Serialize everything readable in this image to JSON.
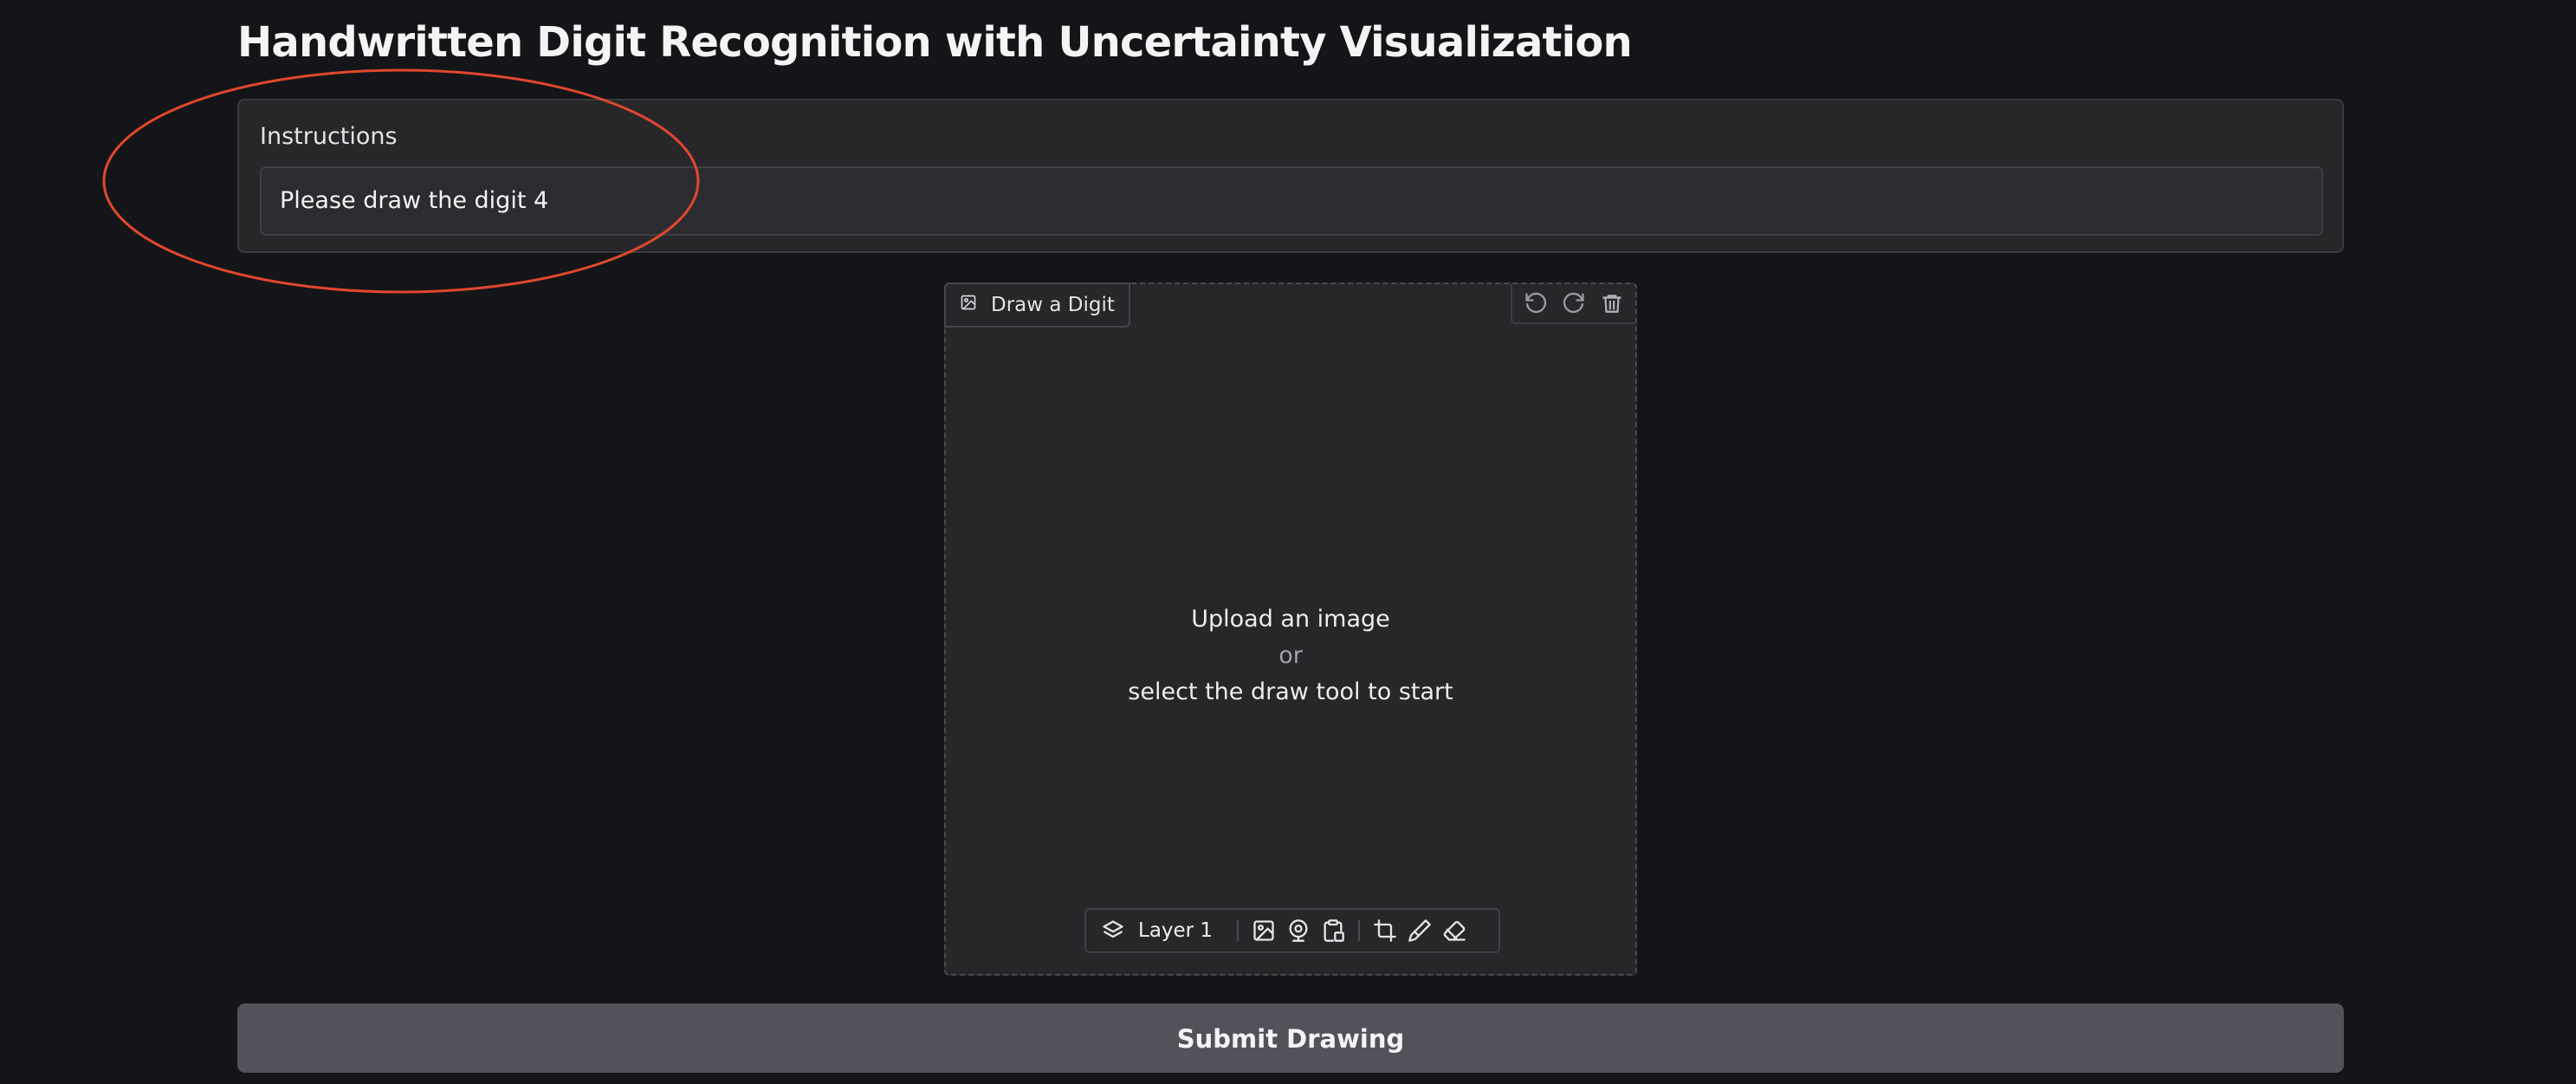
{
  "header": {
    "title": "Handwritten Digit Recognition with Uncertainty Visualization"
  },
  "instructions": {
    "label": "Instructions",
    "value": "Please draw the digit 4"
  },
  "editor": {
    "tab_label": "Draw a Digit",
    "tab_icon": "image-icon",
    "actions": [
      "undo-icon",
      "redo-icon",
      "trash-icon"
    ],
    "prompt": {
      "line1": "Upload an image",
      "line2": "or",
      "line3": "select the draw tool to start"
    },
    "toolbar": {
      "layer_label": "Layer 1",
      "icons": [
        "layers-icon",
        "upload-image-icon",
        "webcam-icon",
        "paste-clipboard-icon",
        "crop-icon",
        "brush-icon",
        "eraser-icon"
      ]
    }
  },
  "submit": {
    "label": "Submit Drawing"
  },
  "colors": {
    "background": "#141518",
    "panel": "#27272a",
    "annotation": "#e0472e",
    "button": "#52525b"
  }
}
